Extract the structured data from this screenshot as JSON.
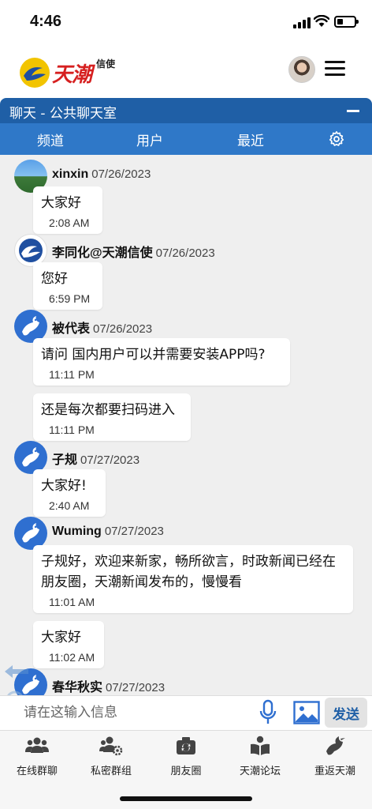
{
  "status_bar": {
    "time": "4:46",
    "battery_level": 0.35
  },
  "app": {
    "logo_name": "天潮",
    "logo_sub": "信使"
  },
  "chat_panel": {
    "title": "聊天 - 公共聊天室",
    "tabs": [
      "频道",
      "用户",
      "最近"
    ]
  },
  "messages": [
    {
      "user": "xinxin",
      "date": "07/26/2023",
      "avatar": "photo",
      "bubbles": [
        {
          "text": "大家好",
          "time": "2:08 AM"
        }
      ]
    },
    {
      "user": "李同化@天潮信使",
      "date": "07/26/2023",
      "avatar": "logo",
      "bubbles": [
        {
          "text": "您好",
          "time": "6:59 PM"
        }
      ]
    },
    {
      "user": "被代表",
      "date": "07/26/2023",
      "avatar": "bird",
      "bubbles": [
        {
          "text": "请问 国内用户可以并需要安装APP吗?",
          "time": "11:11 PM"
        },
        {
          "text": "还是每次都要扫码进入",
          "time": "11:11 PM"
        }
      ]
    },
    {
      "user": "子规",
      "date": "07/27/2023",
      "avatar": "bird",
      "bubbles": [
        {
          "text": "大家好!",
          "time": "2:40 AM"
        }
      ]
    },
    {
      "user": "Wuming",
      "date": "07/27/2023",
      "avatar": "bird",
      "bubbles": [
        {
          "text": "子规好，欢迎来新家，畅所欲言，时政新闻已经在朋友圈，天潮新闻发布的，慢慢看",
          "time": "11:01 AM"
        },
        {
          "text": "大家好",
          "time": "11:02 AM"
        }
      ]
    },
    {
      "user": "春华秋实",
      "date": "07/27/2023",
      "avatar": "bird",
      "bubbles": []
    }
  ],
  "input": {
    "placeholder": "请在这输入信息",
    "send_label": "发送"
  },
  "bottom_nav": [
    {
      "label": "在线群聊",
      "icon": "users-icon"
    },
    {
      "label": "私密群组",
      "icon": "user-group-gear-icon"
    },
    {
      "label": "朋友圈",
      "icon": "camera-icon"
    },
    {
      "label": "天潮论坛",
      "icon": "book-reader-icon"
    },
    {
      "label": "重返天潮",
      "icon": "dove-icon"
    }
  ],
  "colors": {
    "header_dark": "#1f5fa6",
    "header_light": "#2f78c8",
    "avatar_blue": "#2f6fd0",
    "logo_red": "#d62020"
  }
}
